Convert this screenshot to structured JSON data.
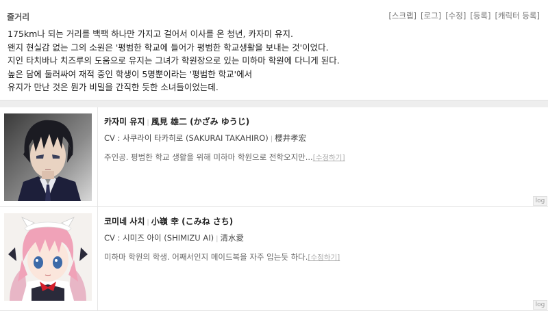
{
  "summary": {
    "title": "줄거리",
    "toolbar": [
      "[스크랩]",
      "[로그]",
      "[수정]",
      "[등록]",
      "[캐릭터 등록]"
    ],
    "lines": [
      "175km나 되는 거리를 백팩 하나만 가지고 걸어서 이사를 온 청년, 카자미 유지.",
      "왠지 현실감 없는 그의 소원은 '평범한 학교에 들어가 평범한 학교생활을 보내는 것'이었다.",
      "지인 타치바나 치즈루의 도움으로 유지는 그녀가 학원장으로 있는 미하마 학원에 다니게 된다.",
      "높은 담에 둘러싸여 재적 중인 학생이 5명뿐이라는 '평범한 학교'에서",
      "유지가 만난 것은 뭔가 비밀을 간직한 듯한 소녀들이었는데."
    ]
  },
  "characters": [
    {
      "name_ko": "카자미 유지",
      "name_jp": "風見 雄二 (かざみ ゆうじ)",
      "cv_ko": "CV : 사쿠라이 타카히로 (SAKURAI TAKAHIRO)",
      "cv_jp": "櫻井孝宏",
      "desc": "주인공. 평범한 학교 생활을 위해 미하마 학원으로 전학오지만...",
      "edit_label": "[수정하기]",
      "log_label": "log",
      "portrait_icon": "dark-haired-boy-portrait"
    },
    {
      "name_ko": "코미네 사치",
      "name_jp": "小嶺 幸 (こみね さち)",
      "cv_ko": "CV : 시미즈 아이 (SHIMIZU AI)",
      "cv_jp": "清水愛",
      "desc": "미하마 학원의 학생. 어째서인지 메이드복을 자주 입는듯 하다.",
      "edit_label": "[수정하기]",
      "log_label": "log",
      "portrait_icon": "pink-haired-maid-girl-portrait"
    }
  ]
}
